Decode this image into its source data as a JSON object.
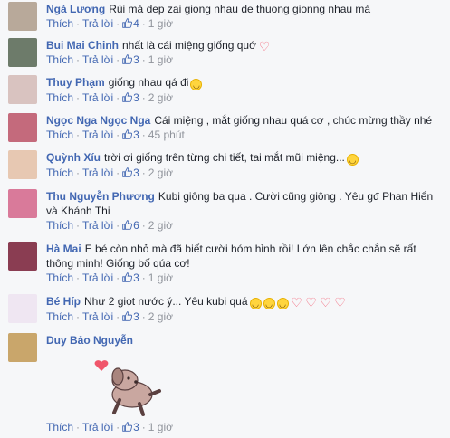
{
  "comments": [
    {
      "name": "Ngà Lương",
      "text": "Rùi mà dep zai giong nhau de thuong gionng nhau mà",
      "emoji": [],
      "like": "Thích",
      "reply": "Trả lời",
      "likes": "4",
      "time": "1 giờ",
      "avatar_color": "#b8a99a"
    },
    {
      "name": "Bui Mai Chinh",
      "text": "nhất là cái miệng giống quớ",
      "emoji": [
        "heart"
      ],
      "like": "Thích",
      "reply": "Trả lời",
      "likes": "3",
      "time": "1 giờ",
      "avatar_color": "#6d7b6a"
    },
    {
      "name": "Thuy Phạm",
      "text": "giống nhau qá đi",
      "emoji": [
        "face"
      ],
      "like": "Thích",
      "reply": "Trả lời",
      "likes": "3",
      "time": "2 giờ",
      "avatar_color": "#d9c3c0"
    },
    {
      "name": "Ngọc Nga Ngọc Nga",
      "text": "Cái miệng , mắt giống nhau quá cơ , chúc mừng thầy nhé",
      "emoji": [],
      "like": "Thích",
      "reply": "Trả lời",
      "likes": "3",
      "time": "45 phút",
      "avatar_color": "#c46a7c"
    },
    {
      "name": "Quỳnh Xíu",
      "text": "trời ơi giống trên từng chi tiết, tai mắt mũi miệng...",
      "emoji": [
        "face"
      ],
      "like": "Thích",
      "reply": "Trả lời",
      "likes": "3",
      "time": "2 giờ",
      "avatar_color": "#e7c8b2"
    },
    {
      "name": "Thu Nguyễn Phương",
      "text": "Kubi giông ba qua . Cười cũng giông . Yêu gđ Phan Hiển và Khánh Thi",
      "emoji": [],
      "like": "Thích",
      "reply": "Trả lời",
      "likes": "6",
      "time": "2 giờ",
      "avatar_color": "#d97a9a"
    },
    {
      "name": "Hà Mai",
      "text": "E bé còn nhỏ mà đã biết cười hóm hỉnh rồi! Lớn lên chắc chắn sẽ rất thông minh! Giống bố qúa cơ!",
      "emoji": [],
      "like": "Thích",
      "reply": "Trả lời",
      "likes": "3",
      "time": "1 giờ",
      "avatar_color": "#8a3d52"
    },
    {
      "name": "Bé Híp",
      "text": "Như 2 giọt nước ý... Yêu kubi quá",
      "emoji": [
        "face",
        "face",
        "face",
        "heart",
        "heart",
        "heart",
        "heart"
      ],
      "like": "Thích",
      "reply": "Trả lời",
      "likes": "3",
      "time": "2 giờ",
      "avatar_color": "#efe6f2"
    },
    {
      "name": "Duy Bảo Nguyễn",
      "text": "",
      "emoji": [],
      "like": "Thích",
      "reply": "Trả lời",
      "likes": "3",
      "time": "1 giờ",
      "avatar_color": "#c9a66b"
    }
  ]
}
